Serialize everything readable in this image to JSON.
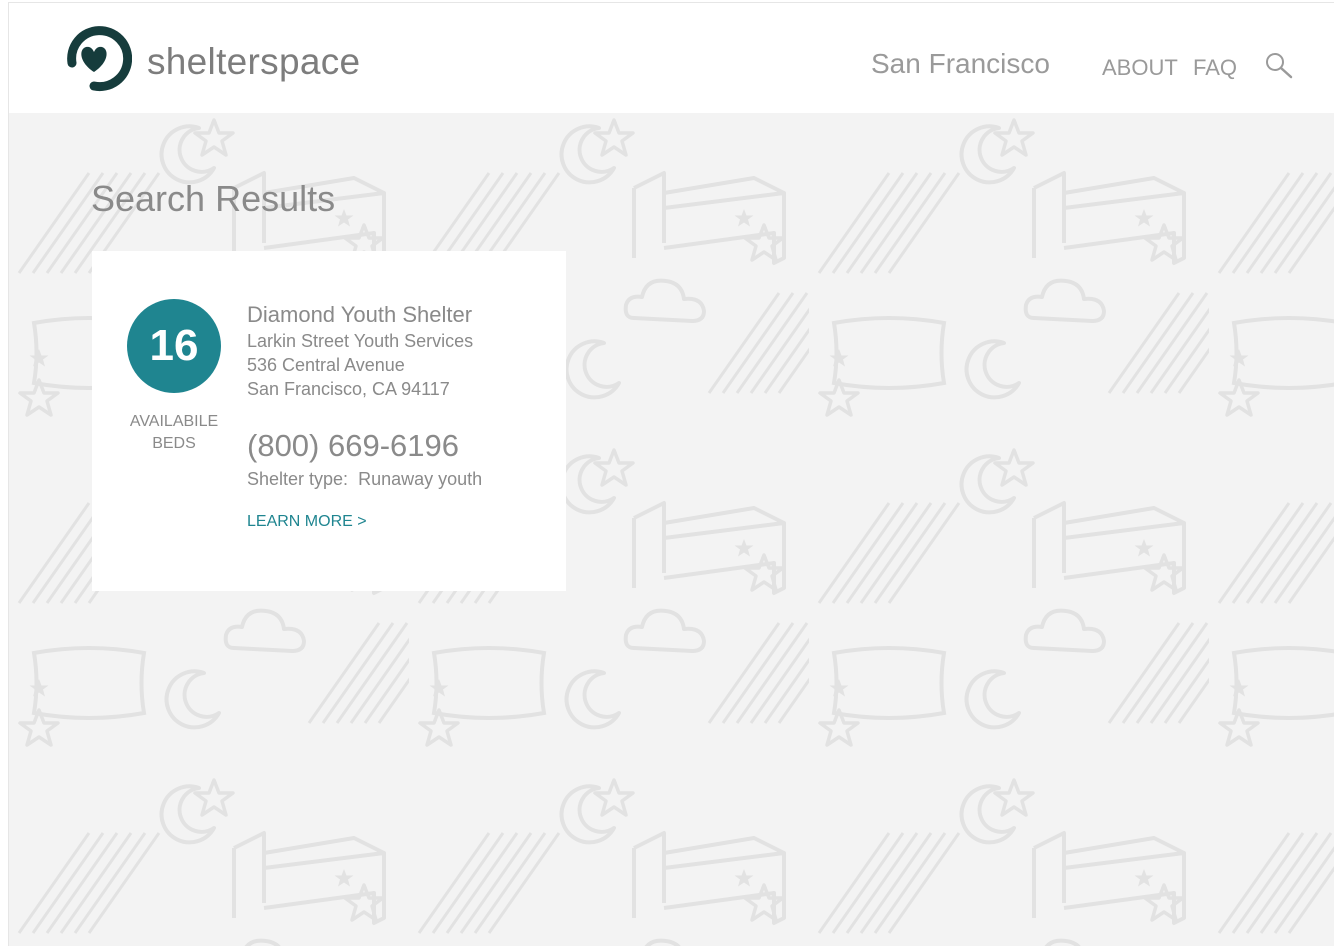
{
  "header": {
    "brand": "shelterspace",
    "city": "San Francisco",
    "nav": {
      "about": "ABOUT",
      "faq": "FAQ"
    },
    "icons": {
      "logo": "heart-ring-logo-icon",
      "search": "search-icon"
    }
  },
  "main": {
    "title": "Search Results",
    "results": [
      {
        "beds_count": "16",
        "beds_label_line1": "AVAILABILE",
        "beds_label_line2": "BEDS",
        "name": "Diamond Youth Shelter",
        "organization": "Larkin Street Youth Services",
        "address_line1": "536 Central Avenue",
        "address_line2": "San Francisco, CA 94117",
        "phone": "(800) 669-6196",
        "shelter_type_label": "Shelter type:",
        "shelter_type": "Runaway youth",
        "learn_more": "LEARN MORE >"
      }
    ]
  },
  "colors": {
    "accent": "#1f8590",
    "logo": "#163c3c",
    "text_gray": "#8a8a8a",
    "background": "#f3f3f3"
  }
}
